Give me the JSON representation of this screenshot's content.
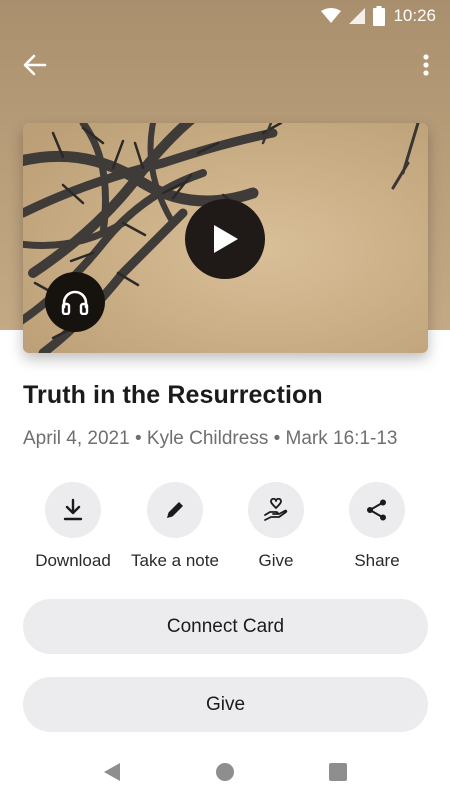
{
  "status_bar": {
    "time": "10:26"
  },
  "sermon": {
    "title": "Truth in the Resurrection",
    "meta": "April 4, 2021 • Kyle Childress • Mark 16:1-13"
  },
  "actions": [
    {
      "label": "Download",
      "icon": "download-icon"
    },
    {
      "label": "Take a note",
      "icon": "pencil-icon"
    },
    {
      "label": "Give",
      "icon": "giving-hand-icon"
    },
    {
      "label": "Share",
      "icon": "share-icon"
    }
  ],
  "buttons": {
    "connect_card": "Connect Card",
    "give": "Give"
  },
  "icons": {
    "back": "arrow-left-icon",
    "more": "more-vertical-icon",
    "play": "play-icon",
    "audio": "headphones-icon"
  },
  "colors": {
    "hero_bg": "#b89d79",
    "button_bg": "#ececee",
    "play_bg": "#1f1a17"
  }
}
